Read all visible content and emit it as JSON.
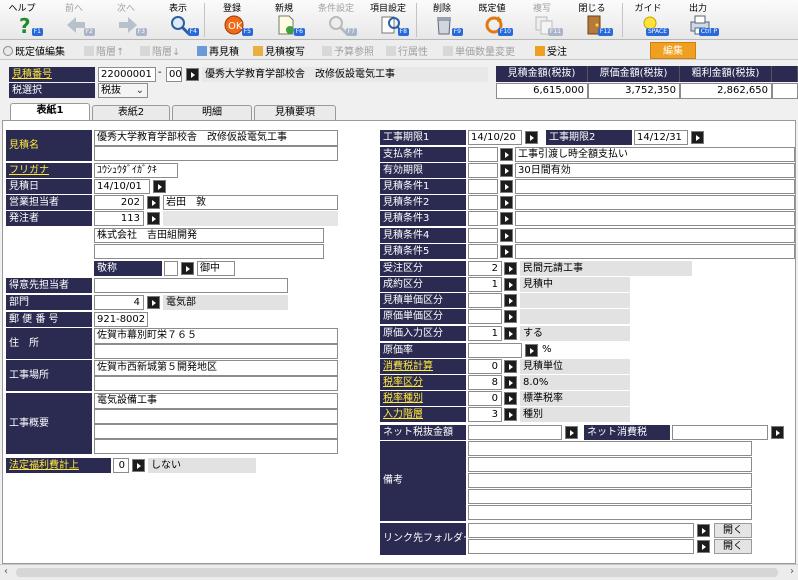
{
  "toolbar": {
    "help": {
      "label": "ヘルプ",
      "key": "F1"
    },
    "prev": {
      "label": "前へ",
      "key": "F2"
    },
    "next": {
      "label": "次へ",
      "key": "F3"
    },
    "view": {
      "label": "表示",
      "key": "F4"
    },
    "register": {
      "label": "登録",
      "key": "F5"
    },
    "new": {
      "label": "新規",
      "key": "F6"
    },
    "cond": {
      "label": "条件設定",
      "key": "F7"
    },
    "itemset": {
      "label": "項目設定",
      "key": "F8"
    },
    "delete": {
      "label": "削除",
      "key": "F9"
    },
    "default": {
      "label": "既定値",
      "key": "F10"
    },
    "copy": {
      "label": "複写",
      "key": "F11"
    },
    "close": {
      "label": "閉じる",
      "key": "F12"
    },
    "guide": {
      "label": "ガイド",
      "key": "SPACE"
    },
    "output": {
      "label": "出力",
      "key": "Ctrl P"
    }
  },
  "toolbar2": {
    "default_edit": "既定値編集",
    "level_up": "階層↑",
    "level_down": "階層↓",
    "re_estimate": "再見積",
    "estimate_copy": "見積複写",
    "budget_ref": "予算参照",
    "row_attr": "行属性",
    "unit_qty": "単価数量変更",
    "order": "受注",
    "edit": "編集"
  },
  "header": {
    "estimate_no_label": "見積番号",
    "estimate_no": "22000001",
    "estimate_sub": "00",
    "title": "優秀大学教育学部校舎　改修仮設電気工事",
    "tax_label": "税選択",
    "tax_value": "税抜",
    "amount_headers": [
      "見積金額(税抜)",
      "原価金額(税抜)",
      "粗利金額(税抜)"
    ],
    "amounts": [
      "6,615,000",
      "3,752,350",
      "2,862,650"
    ]
  },
  "tabs": [
    "表紙1",
    "表紙2",
    "明細",
    "見積要項"
  ],
  "left": {
    "estimate_name_label": "見積名",
    "estimate_name": "優秀大学教育学部校舎　改修仮設電気工事",
    "furigana_label": "フリガナ",
    "furigana": "ﾕｳｼｭｳﾀﾞｲｶﾞｸｷ",
    "date_label": "見積日",
    "date": "14/10/01",
    "sales_label": "営業担当者",
    "sales_code": "202",
    "sales_name": "岩田　敦",
    "orderer_label": "発注者",
    "orderer_code": "113",
    "orderer_name": "株式会社　吉田組開発",
    "honorific_label": "敬称",
    "honorific": "御中",
    "client_person_label": "得意先担当者",
    "dept_label": "部門",
    "dept_code": "4",
    "dept_name": "電気部",
    "zip_label": "郵 便 番 号",
    "zip": "921-8002",
    "address_label": "住　所",
    "address": "佐賀市幕別町栄７６５",
    "site_label": "工事場所",
    "site": "佐賀市西新城第５開発地区",
    "summary_label": "工事概要",
    "summary": "電気設備工事",
    "welfare_label": "法定福利費計上",
    "welfare_code": "0",
    "welfare_value": "しない"
  },
  "right": {
    "period1_label": "工事期限1",
    "period1": "14/10/20",
    "period2_label": "工事期限2",
    "period2": "14/12/31",
    "pay_label": "支払条件",
    "pay": "工事引渡し時全額支払い",
    "valid_label": "有効期限",
    "valid": "30日間有効",
    "cond_labels": [
      "見積条件1",
      "見積条件2",
      "見積条件3",
      "見積条件4",
      "見積条件5"
    ],
    "order_type_label": "受注区分",
    "order_type_code": "2",
    "order_type": "民間元請工事",
    "result_label": "成約区分",
    "result_code": "1",
    "result": "見積中",
    "est_unit_label": "見積単価区分",
    "cost_unit_label": "原価単価区分",
    "cost_input_label": "原価入力区分",
    "cost_input_code": "1",
    "cost_input": "する",
    "cost_rate_label": "原価率",
    "cost_rate_unit": "%",
    "tax_calc_label": "消費税計算",
    "tax_calc_code": "0",
    "tax_calc": "見積単位",
    "tax_rate_label": "税率区分",
    "tax_rate_code": "8",
    "tax_rate": "8.0%",
    "tax_type_label": "税率種別",
    "tax_type_code": "0",
    "tax_type": "標準税率",
    "input_level_label": "入力階層",
    "input_level_code": "3",
    "input_level": "種別",
    "net_ex_label": "ネット税抜金額",
    "net_tax_label": "ネット消費税",
    "remarks_label": "備考",
    "link_label": "リンク先フォルダー",
    "open": "開く"
  }
}
